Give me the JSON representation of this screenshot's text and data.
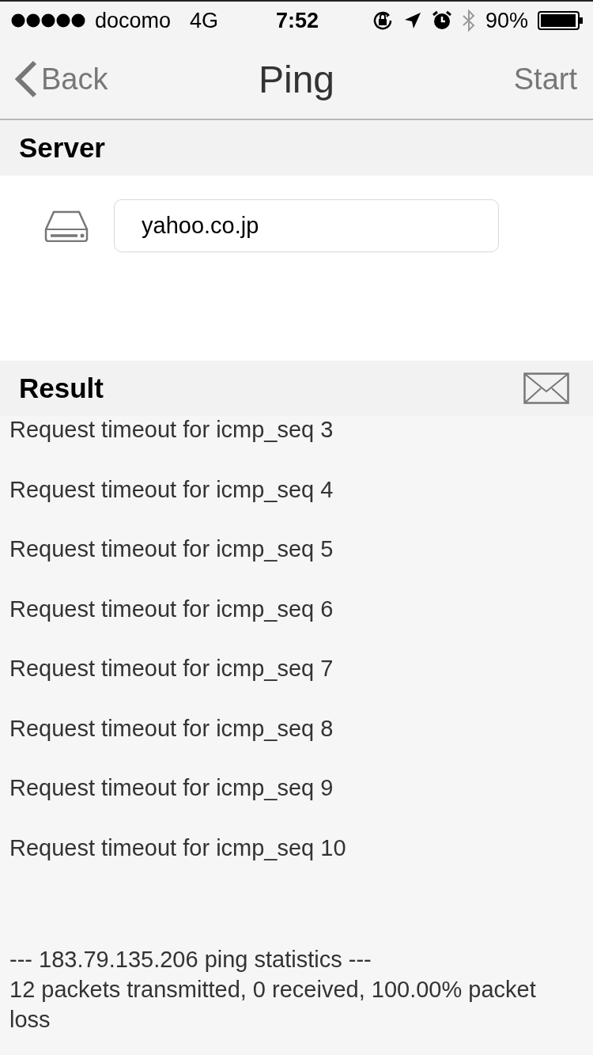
{
  "status_bar": {
    "carrier": "docomo",
    "network": "4G",
    "time": "7:52",
    "battery": "90%"
  },
  "nav": {
    "back": "Back",
    "title": "Ping",
    "action": "Start"
  },
  "server": {
    "header": "Server",
    "host": "yahoo.co.jp"
  },
  "result": {
    "header": "Result",
    "lines": [
      "Request timeout for icmp_seq 3",
      "Request timeout for icmp_seq 4",
      "Request timeout for icmp_seq 5",
      "Request timeout for icmp_seq 6",
      "Request timeout for icmp_seq 7",
      "Request timeout for icmp_seq 8",
      "Request timeout for icmp_seq 9",
      "Request timeout for icmp_seq 10"
    ],
    "statistics": [
      "--- 183.79.135.206 ping statistics ---",
      "12 packets transmitted, 0 received, 100.00% packet loss"
    ]
  }
}
